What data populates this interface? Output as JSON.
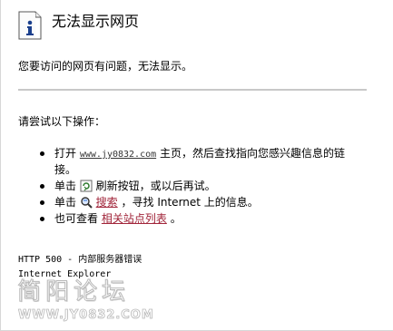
{
  "header": {
    "title": "无法显示网页",
    "icon": "info-page-icon"
  },
  "message": {
    "problem": "您要访问的网页有问题，无法显示。",
    "try_heading": "请尝试以下操作："
  },
  "actions": {
    "open_prefix": "打开",
    "site": "www.jy0832.com",
    "open_suffix_1": "主页，然后查找指向您感兴趣信息的链",
    "open_suffix_2": "接。",
    "click_prefix": "单击",
    "refresh_text": "刷新按钮，或以后再试。",
    "search_link": "搜索",
    "search_suffix": "，寻找 Internet 上的信息。",
    "related_prefix": "也可查看",
    "related_link": "相关站点列表",
    "related_suffix": "。"
  },
  "footer": {
    "error_code": "HTTP 500 - 内部服务器错误",
    "browser": "Internet Explorer"
  },
  "watermark": {
    "chinese": "简阳论坛",
    "url": "WWW.JY0832.COM"
  },
  "colors": {
    "link_red": "#a1253a",
    "divider": "#c8c8c8",
    "icon_blue": "#1a3f8c"
  }
}
